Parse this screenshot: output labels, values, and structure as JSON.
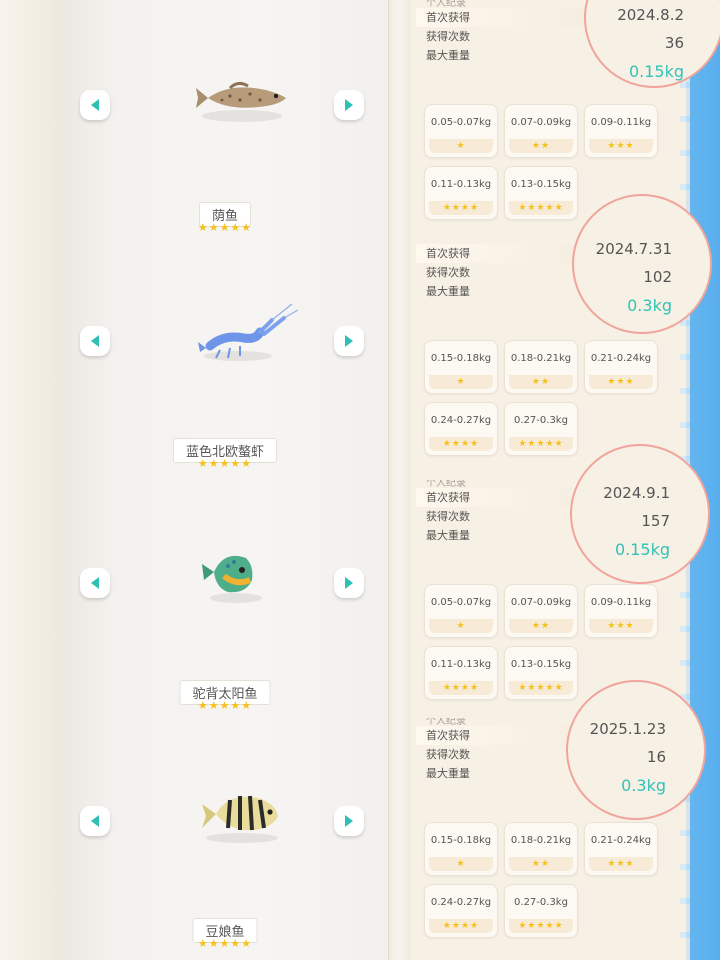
{
  "labels": {
    "first_obtained": "首次获得",
    "obtain_count": "获得次数",
    "max_weight": "最大重量",
    "faded_header": "个人纪录"
  },
  "colors": {
    "accent_teal": "#2ec0b4",
    "star_yellow": "#f5c11c",
    "circle_border": "#f0a49b",
    "water_blue": "#58aeee"
  },
  "fish": [
    {
      "name": "荫鱼",
      "stars": "★★★★★",
      "icon": "fish-icon"
    },
    {
      "name": "蓝色北欧螯虾",
      "stars": "★★★★★",
      "icon": "crayfish-icon"
    },
    {
      "name": "驼背太阳鱼",
      "stars": "★★★★★",
      "icon": "sunfish-icon"
    },
    {
      "name": "豆娘鱼",
      "stars": "★★★★★",
      "icon": "striped-fish-icon"
    }
  ],
  "records": [
    {
      "first_date": "2024.8.2",
      "count": "36",
      "max_weight": "0.15kg",
      "tiers": [
        {
          "range": "0.05-0.07kg",
          "stars": "★"
        },
        {
          "range": "0.07-0.09kg",
          "stars": "★★"
        },
        {
          "range": "0.09-0.11kg",
          "stars": "★★★"
        },
        {
          "range": "0.11-0.13kg",
          "stars": "★★★★"
        },
        {
          "range": "0.13-0.15kg",
          "stars": "★★★★★"
        }
      ]
    },
    {
      "first_date": "2024.7.31",
      "count": "102",
      "max_weight": "0.3kg",
      "tiers": [
        {
          "range": "0.15-0.18kg",
          "stars": "★"
        },
        {
          "range": "0.18-0.21kg",
          "stars": "★★"
        },
        {
          "range": "0.21-0.24kg",
          "stars": "★★★"
        },
        {
          "range": "0.24-0.27kg",
          "stars": "★★★★"
        },
        {
          "range": "0.27-0.3kg",
          "stars": "★★★★★"
        }
      ]
    },
    {
      "first_date": "2024.9.1",
      "count": "157",
      "max_weight": "0.15kg",
      "tiers": [
        {
          "range": "0.05-0.07kg",
          "stars": "★"
        },
        {
          "range": "0.07-0.09kg",
          "stars": "★★"
        },
        {
          "range": "0.09-0.11kg",
          "stars": "★★★"
        },
        {
          "range": "0.11-0.13kg",
          "stars": "★★★★"
        },
        {
          "range": "0.13-0.15kg",
          "stars": "★★★★★"
        }
      ]
    },
    {
      "first_date": "2025.1.23",
      "count": "16",
      "max_weight": "0.3kg",
      "tiers": [
        {
          "range": "0.15-0.18kg",
          "stars": "★"
        },
        {
          "range": "0.18-0.21kg",
          "stars": "★★"
        },
        {
          "range": "0.21-0.24kg",
          "stars": "★★★"
        },
        {
          "range": "0.24-0.27kg",
          "stars": "★★★★"
        },
        {
          "range": "0.27-0.3kg",
          "stars": "★★★★★"
        }
      ]
    }
  ]
}
